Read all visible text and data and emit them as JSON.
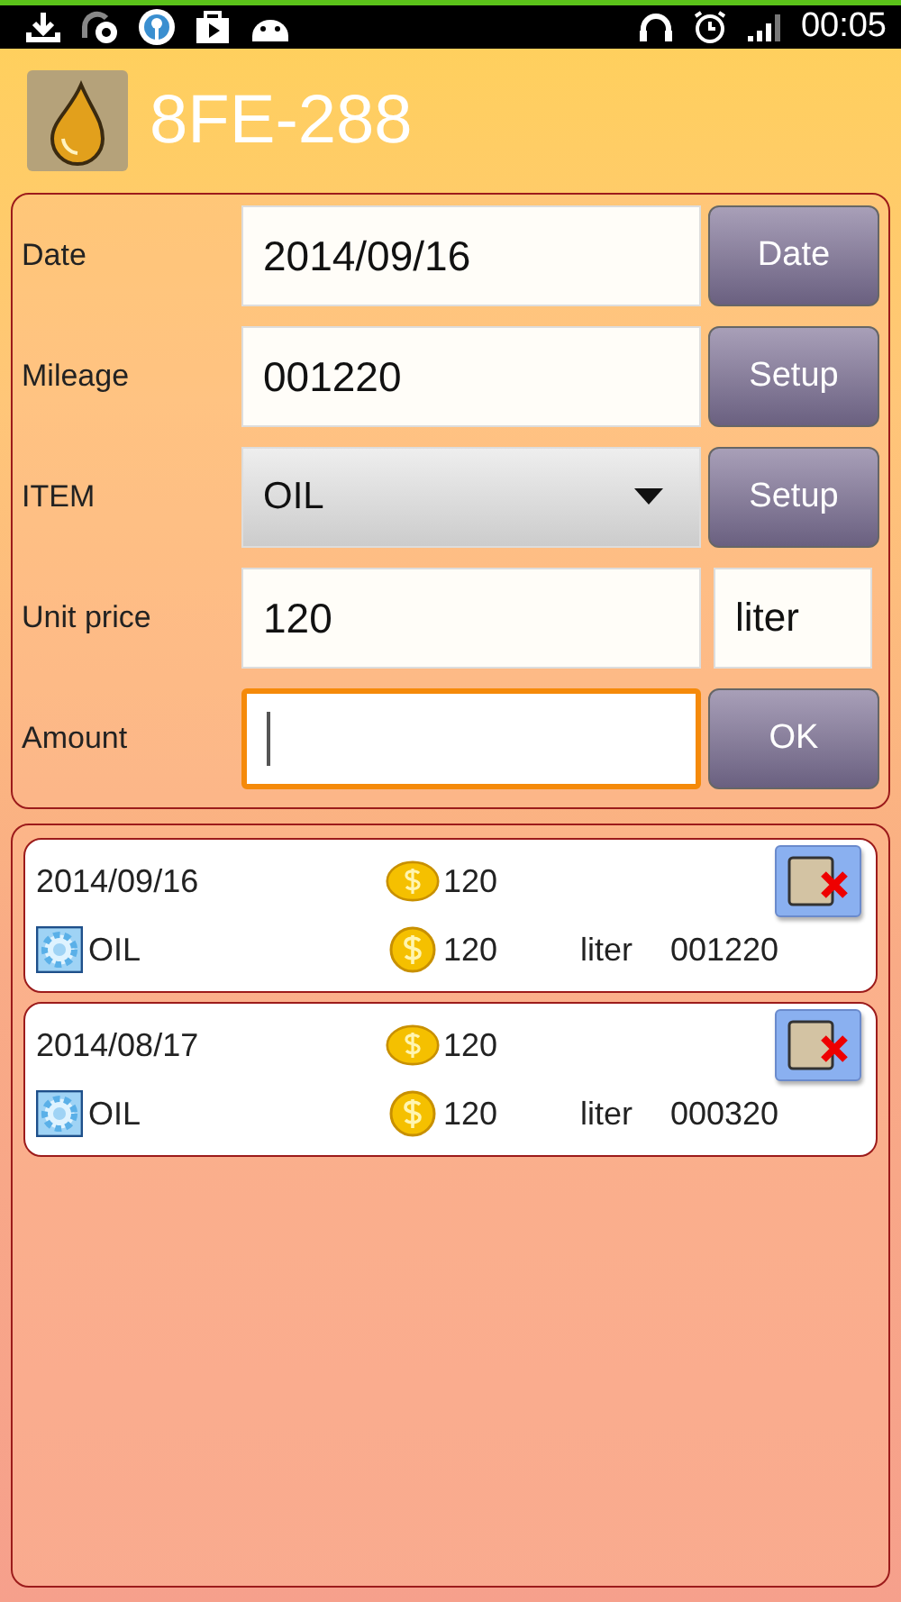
{
  "status_bar": {
    "time": "00:05"
  },
  "header": {
    "title": "8FE-288"
  },
  "form": [
    {
      "label": "Date",
      "kind": "input",
      "value": "2014/09/16",
      "focused": false,
      "side": {
        "kind": "button",
        "label": "Date"
      }
    },
    {
      "label": "Mileage",
      "kind": "input",
      "value": "001220",
      "focused": false,
      "side": {
        "kind": "button",
        "label": "Setup"
      }
    },
    {
      "label": "ITEM",
      "kind": "select",
      "value": "OIL",
      "side": {
        "kind": "button",
        "label": "Setup"
      }
    },
    {
      "label": "Unit price",
      "kind": "input",
      "value": "120",
      "focused": false,
      "side": {
        "kind": "box",
        "label": "liter"
      }
    },
    {
      "label": "Amount",
      "kind": "input",
      "focused": true,
      "side": {
        "kind": "button",
        "label": "OK"
      }
    }
  ],
  "records": [
    {
      "date": "2014/09/16",
      "total": "120",
      "item": "OIL",
      "unit_price": "120",
      "unit": "liter",
      "mileage": "001220"
    },
    {
      "date": "2014/08/17",
      "total": "120",
      "item": "OIL",
      "unit_price": "120",
      "unit": "liter",
      "mileage": "000320"
    }
  ]
}
